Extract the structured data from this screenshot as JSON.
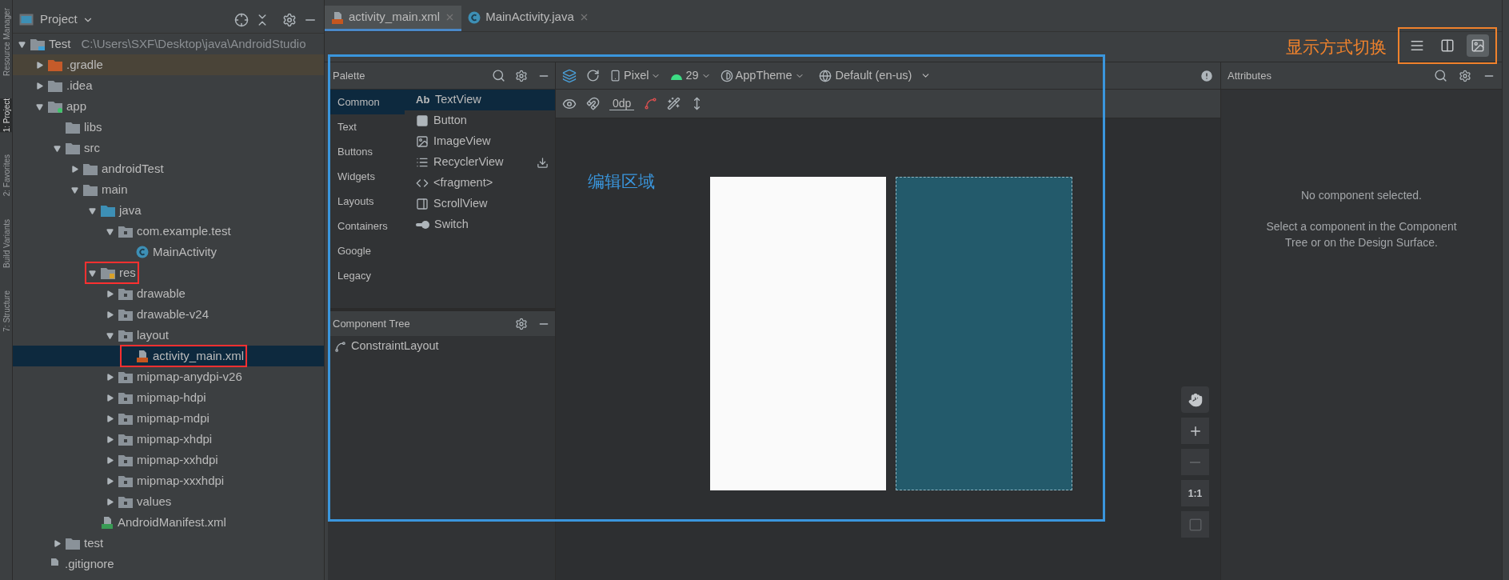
{
  "side_strip": [
    {
      "label": "Resource Manager",
      "selected": false
    },
    {
      "label": "1: Project",
      "selected": true
    },
    {
      "label": "2: Favorites",
      "selected": false
    },
    {
      "label": "Build Variants",
      "selected": false
    },
    {
      "label": "7: Structure",
      "selected": false
    }
  ],
  "project_panel": {
    "title": "Project",
    "tree": [
      {
        "name": "Test",
        "detail": "C:\\Users\\SXF\\Desktop\\java\\AndroidStudio",
        "kind": "project",
        "expanded": true,
        "selected": false,
        "children": [
          {
            "name": ".gradle",
            "kind": "excluded_folder",
            "expanded": false,
            "selected": false
          },
          {
            "name": ".idea",
            "kind": "folder",
            "expanded": false,
            "selected": false
          },
          {
            "name": "app",
            "kind": "module",
            "expanded": true,
            "selected": false,
            "children": [
              {
                "name": "libs",
                "kind": "folder",
                "selected": false
              },
              {
                "name": "src",
                "kind": "folder",
                "expanded": true,
                "selected": false,
                "children": [
                  {
                    "name": "androidTest",
                    "kind": "folder",
                    "expanded": false,
                    "selected": false
                  },
                  {
                    "name": "main",
                    "kind": "folder",
                    "expanded": true,
                    "selected": false,
                    "children": [
                      {
                        "name": "java",
                        "kind": "source_folder",
                        "expanded": true,
                        "selected": false,
                        "children": [
                          {
                            "name": "com.example.test",
                            "kind": "package",
                            "expanded": true,
                            "selected": false,
                            "children": [
                              {
                                "name": "MainActivity",
                                "kind": "class",
                                "selected": false
                              }
                            ]
                          }
                        ]
                      },
                      {
                        "name": "res",
                        "kind": "res_folder",
                        "expanded": true,
                        "selected": false,
                        "annotated": true,
                        "children": [
                          {
                            "name": "drawable",
                            "kind": "package",
                            "expanded": false,
                            "selected": false
                          },
                          {
                            "name": "drawable-v24",
                            "kind": "package",
                            "expanded": false,
                            "selected": false
                          },
                          {
                            "name": "layout",
                            "kind": "package",
                            "expanded": true,
                            "selected": false,
                            "children": [
                              {
                                "name": "activity_main.xml",
                                "kind": "layout_file",
                                "selected": true,
                                "annotated": true
                              }
                            ]
                          },
                          {
                            "name": "mipmap-anydpi-v26",
                            "kind": "package",
                            "expanded": false,
                            "selected": false
                          },
                          {
                            "name": "mipmap-hdpi",
                            "kind": "package",
                            "expanded": false,
                            "selected": false
                          },
                          {
                            "name": "mipmap-mdpi",
                            "kind": "package",
                            "expanded": false,
                            "selected": false
                          },
                          {
                            "name": "mipmap-xhdpi",
                            "kind": "package",
                            "expanded": false,
                            "selected": false
                          },
                          {
                            "name": "mipmap-xxhdpi",
                            "kind": "package",
                            "expanded": false,
                            "selected": false
                          },
                          {
                            "name": "mipmap-xxxhdpi",
                            "kind": "package",
                            "expanded": false,
                            "selected": false
                          },
                          {
                            "name": "values",
                            "kind": "package",
                            "expanded": false,
                            "selected": false
                          }
                        ]
                      },
                      {
                        "name": "AndroidManifest.xml",
                        "kind": "manifest_file",
                        "selected": false
                      }
                    ]
                  }
                ]
              },
              {
                "name": "test",
                "kind": "folder",
                "expanded": false,
                "selected": false
              }
            ]
          },
          {
            "name": ".gitignore",
            "kind": "file",
            "selected": false
          }
        ]
      }
    ]
  },
  "editor_tabs": [
    {
      "label": "activity_main.xml",
      "kind": "layout_file",
      "selected": true
    },
    {
      "label": "MainActivity.java",
      "kind": "class",
      "selected": false
    }
  ],
  "view_switch": {
    "annotation": "显示方式切换",
    "modes": [
      {
        "kind": "code",
        "selected": false
      },
      {
        "kind": "split",
        "selected": false
      },
      {
        "kind": "design",
        "selected": true
      }
    ]
  },
  "palette": {
    "title": "Palette",
    "categories": [
      {
        "label": "Common",
        "selected": true
      },
      {
        "label": "Text",
        "selected": false
      },
      {
        "label": "Buttons",
        "selected": false
      },
      {
        "label": "Widgets",
        "selected": false
      },
      {
        "label": "Layouts",
        "selected": false
      },
      {
        "label": "Containers",
        "selected": false
      },
      {
        "label": "Google",
        "selected": false
      },
      {
        "label": "Legacy",
        "selected": false
      }
    ],
    "items": [
      {
        "label": "TextView",
        "kind": "text",
        "icon_text": "Ab",
        "selected": true
      },
      {
        "label": "Button",
        "kind": "button",
        "selected": false
      },
      {
        "label": "ImageView",
        "kind": "image",
        "selected": false
      },
      {
        "label": "RecyclerView",
        "kind": "list",
        "selected": false,
        "downloadable": true
      },
      {
        "label": "<fragment>",
        "kind": "fragment",
        "selected": false
      },
      {
        "label": "ScrollView",
        "kind": "scroll",
        "selected": false
      },
      {
        "label": "Switch",
        "kind": "switch",
        "selected": false
      }
    ]
  },
  "component_tree": {
    "title": "Component Tree",
    "nodes": [
      {
        "label": "ConstraintLayout"
      }
    ]
  },
  "design_toolbar": {
    "device": "Pixel",
    "api": "29",
    "theme": "AppTheme",
    "locale": "Default (en-us)",
    "margin": "0dp"
  },
  "canvas": {
    "annotation": "编辑区域"
  },
  "zoom_controls": [
    {
      "kind": "pan",
      "disabled": false
    },
    {
      "kind": "zoom_in",
      "disabled": false
    },
    {
      "kind": "zoom_out",
      "disabled": true
    },
    {
      "kind": "actual_size",
      "label": "1:1",
      "disabled": false
    },
    {
      "kind": "fit",
      "disabled": true
    }
  ],
  "attributes": {
    "title": "Attributes",
    "empty_title": "No component selected.",
    "empty_hint": "Select a component in the Component Tree or on the Design Surface."
  }
}
